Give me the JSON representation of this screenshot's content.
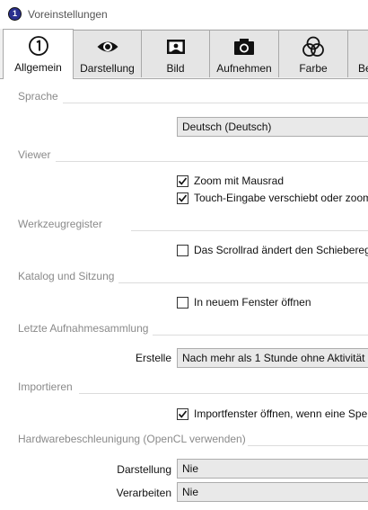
{
  "window": {
    "title": "Voreinstellungen",
    "icon": "capture-one-app-icon"
  },
  "tabs": [
    {
      "label": "Allgemein",
      "icon": "general-1-icon",
      "active": true
    },
    {
      "label": "Darstellung",
      "icon": "eye-icon",
      "active": false
    },
    {
      "label": "Bild",
      "icon": "image-frame-icon",
      "active": false
    },
    {
      "label": "Aufnehmen",
      "icon": "camera-icon",
      "active": false
    },
    {
      "label": "Farbe",
      "icon": "color-circles-icon",
      "active": false
    },
    {
      "label": "Be",
      "icon": "",
      "active": false
    }
  ],
  "sections": {
    "sprache": {
      "title": "Sprache",
      "language_value": "Deutsch (Deutsch)"
    },
    "viewer": {
      "title": "Viewer",
      "zoom_wheel": {
        "label": "Zoom mit Mausrad",
        "checked": true
      },
      "touch_pan": {
        "label": "Touch-Eingabe verschiebt oder zoomt",
        "checked": true
      }
    },
    "werkzeugregister": {
      "title": "Werkzeugregister",
      "scroll_slider": {
        "label": "Das Scrollrad ändert den Schieberegler",
        "checked": false
      }
    },
    "katalog": {
      "title": "Katalog und Sitzung",
      "new_window": {
        "label": "In neuem Fenster öffnen",
        "checked": false
      }
    },
    "letzte": {
      "title": "Letzte Aufnahmesammlung",
      "create_label": "Erstelle",
      "create_value": "Nach mehr als 1 Stunde ohne Aktivität"
    },
    "importieren": {
      "title": "Importieren",
      "open_import": {
        "label": "Importfenster öffnen, wenn eine Speicherkarte erkannt wird",
        "checked": true
      }
    },
    "hardware": {
      "title": "Hardwarebeschleunigung (OpenCL verwenden)",
      "display_label": "Darstellung",
      "display_value": "Nie",
      "processing_label": "Verarbeiten",
      "processing_value": "Nie"
    }
  },
  "colors": {
    "section_text": "#8a8a8a",
    "tab_active": "#ffffff",
    "tab_inactive": "#e5e5e5",
    "combo_bg": "#e9e9e9"
  }
}
